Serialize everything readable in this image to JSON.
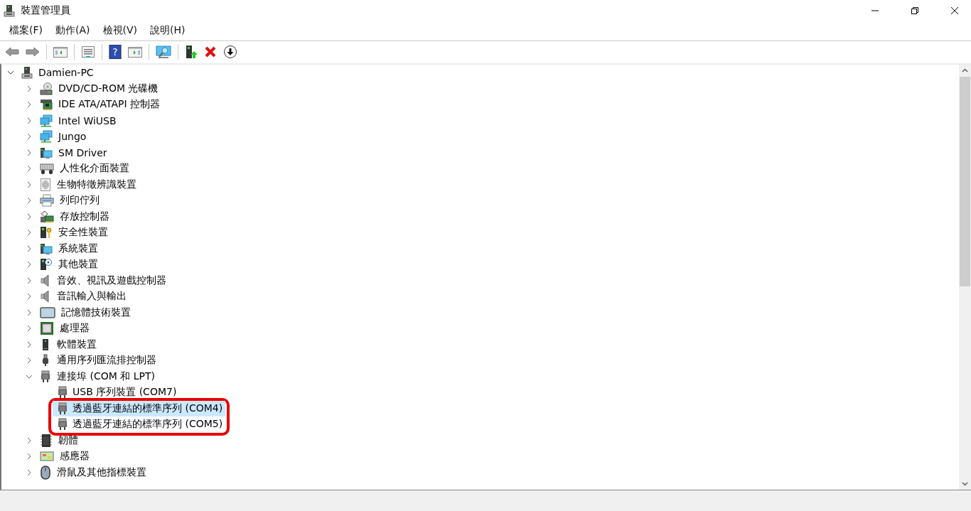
{
  "window": {
    "title": "裝置管理員"
  },
  "toolbar": {
    "help_glyph": "?"
  },
  "menu": [
    {
      "label": "檔案(F)"
    },
    {
      "label": "動作(A)"
    },
    {
      "label": "檢視(V)"
    },
    {
      "label": "說明(H)"
    }
  ],
  "tree": {
    "label": "Damien-PC",
    "expanded": true,
    "children": [
      {
        "label": "DVD/CD-ROM 光碟機",
        "expanded": false
      },
      {
        "label": "IDE ATA/ATAPI 控制器",
        "expanded": false
      },
      {
        "label": "Intel WiUSB",
        "expanded": false
      },
      {
        "label": "Jungo",
        "expanded": false
      },
      {
        "label": "SM Driver",
        "expanded": false
      },
      {
        "label": "人性化介面裝置",
        "expanded": false
      },
      {
        "label": "生物特徵辨識裝置",
        "expanded": false
      },
      {
        "label": "列印佇列",
        "expanded": false
      },
      {
        "label": "存放控制器",
        "expanded": false
      },
      {
        "label": "安全性裝置",
        "expanded": false
      },
      {
        "label": "系統裝置",
        "expanded": false
      },
      {
        "label": "其他裝置",
        "expanded": false
      },
      {
        "label": "音效、視訊及遊戲控制器",
        "expanded": false
      },
      {
        "label": "音訊輸入與輸出",
        "expanded": false
      },
      {
        "label": "記憶體技術裝置",
        "expanded": false
      },
      {
        "label": "處理器",
        "expanded": false
      },
      {
        "label": "軟體裝置",
        "expanded": false
      },
      {
        "label": "通用序列匯流排控制器",
        "expanded": false
      },
      {
        "label": "連接埠 (COM 和 LPT)",
        "expanded": true,
        "children": [
          {
            "label": "USB 序列裝置 (COM7)",
            "selected": false,
            "highlighted": false
          },
          {
            "label": "透過藍牙連結的標準序列 (COM4)",
            "selected": true,
            "highlighted": true
          },
          {
            "label": "透過藍牙連結的標準序列 (COM5)",
            "selected": false,
            "highlighted": true
          }
        ]
      },
      {
        "label": "韌體",
        "expanded": false
      },
      {
        "label": "感應器",
        "expanded": false
      },
      {
        "label": "滑鼠及其他指標裝置",
        "expanded": false
      }
    ]
  }
}
